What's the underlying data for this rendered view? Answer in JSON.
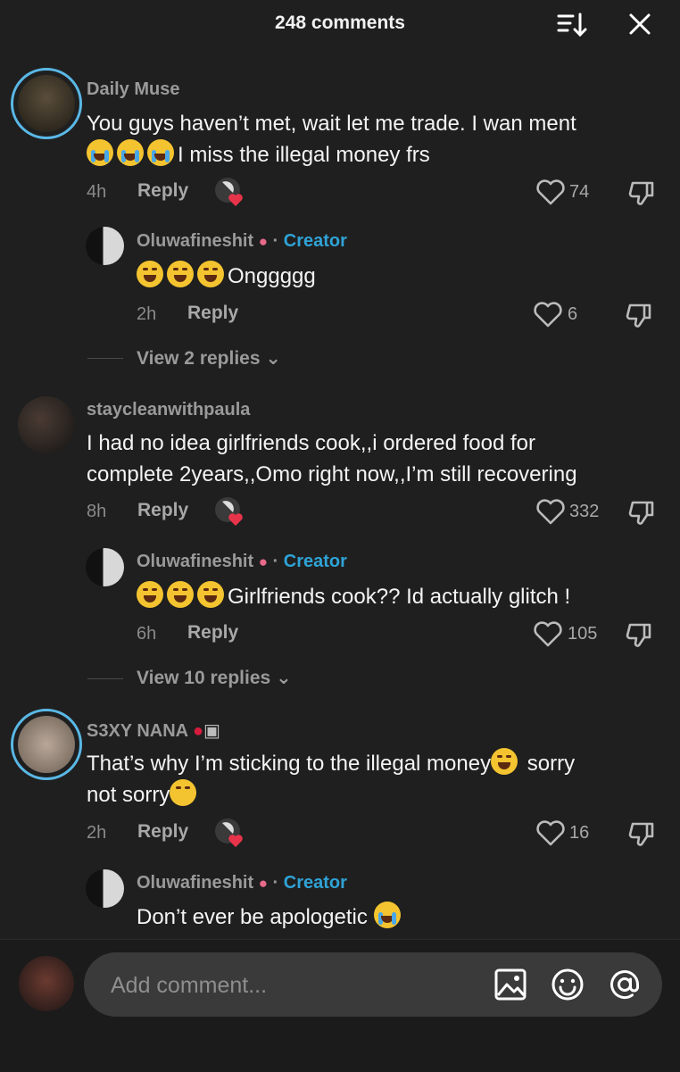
{
  "header": {
    "title": "248 comments"
  },
  "comments": [
    {
      "username": "Daily Muse",
      "text": "You guys haven’t met, wait let me trade. I wan ment",
      "text2": "I miss the illegal money frs",
      "time": "4h",
      "reply": "Reply",
      "likes": "74",
      "creator_reply": {
        "username": "Oluwafineshit",
        "badge": "Creator",
        "text": "Onggggg",
        "time": "2h",
        "reply": "Reply",
        "likes": "6"
      },
      "view_replies": "View 2 replies"
    },
    {
      "username": "staycleanwithpaula",
      "text": "I had no idea girlfriends cook,,i ordered food for",
      "text2": "complete 2years,,Omo right now,,I’m still recovering",
      "time": "8h",
      "reply": "Reply",
      "likes": "332",
      "creator_reply": {
        "username": "Oluwafineshit",
        "badge": "Creator",
        "text": "Girlfriends cook?? Id actually glitch !",
        "time": "6h",
        "reply": "Reply",
        "likes": "105"
      },
      "view_replies": "View 10 replies"
    },
    {
      "username": "S3XY NANA",
      "text": "That’s why I’m sticking to the illegal money",
      "text_tail": " sorry",
      "text2": "not sorry",
      "time": "2h",
      "reply": "Reply",
      "likes": "16",
      "creator_reply": {
        "username": "Oluwafineshit",
        "badge": "Creator",
        "text": "Don’t ever be apologetic "
      }
    }
  ],
  "composer": {
    "placeholder": "Add comment..."
  },
  "colors": {
    "background": "#1f1f1f",
    "creator": "#2fa3d6",
    "ring": "#5ab8e6",
    "heart": "#e8344a"
  },
  "icons": [
    "sort-icon",
    "close-icon",
    "heart-outline-icon",
    "dislike-icon",
    "creator-liked-icon",
    "image-icon",
    "emoji-icon",
    "at-icon"
  ]
}
